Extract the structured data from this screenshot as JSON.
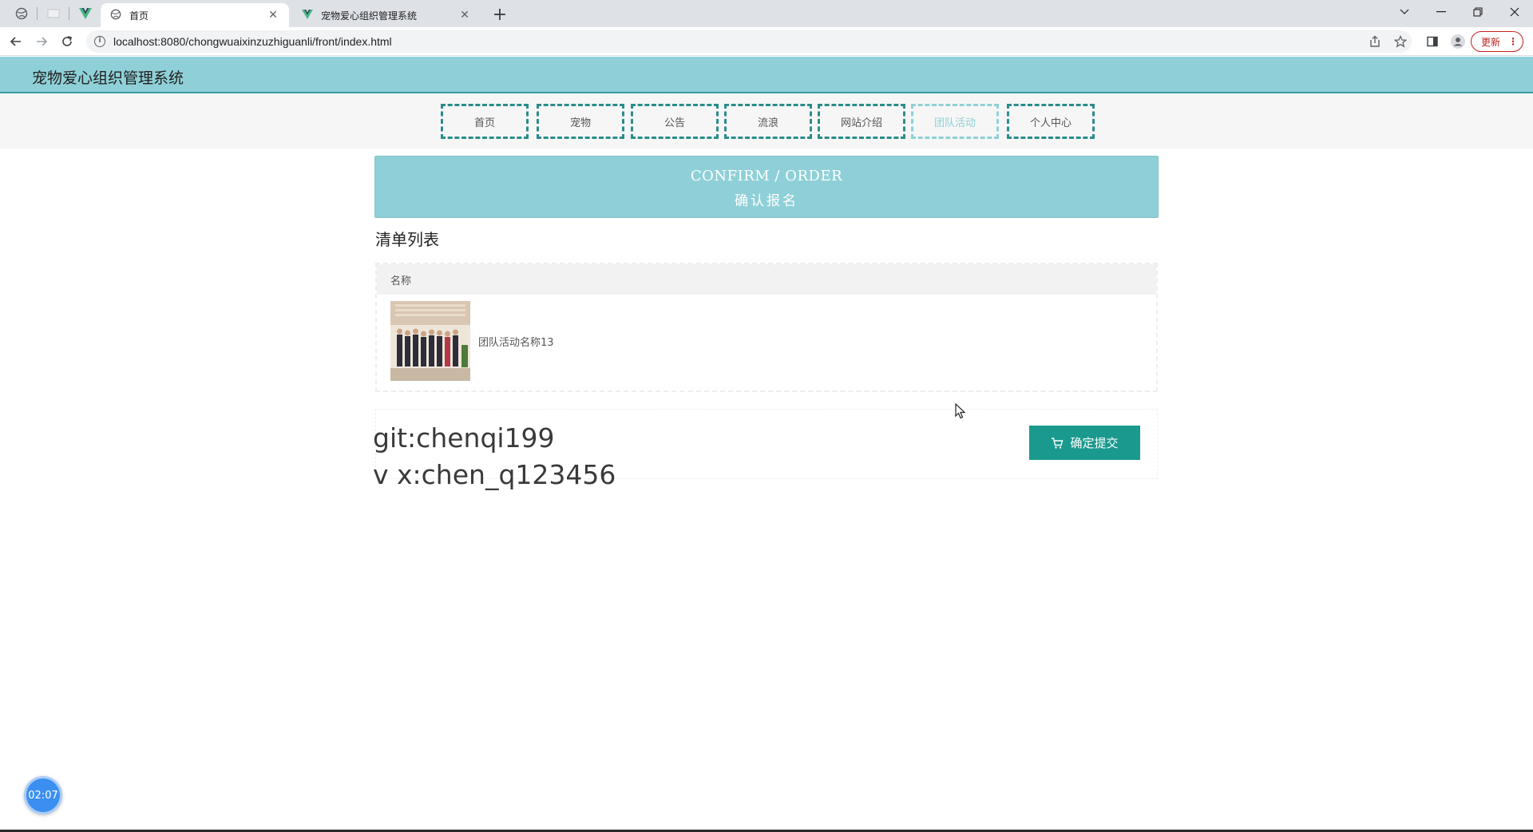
{
  "browser": {
    "tabs": [
      {
        "title": "首页",
        "active": true
      },
      {
        "title": "宠物爱心组织管理系统",
        "active": false
      }
    ],
    "url": "localhost:8080/chongwuaixinzuzhiguanli/front/index.html",
    "update_label": "更新"
  },
  "site": {
    "title": "宠物爱心组织管理系统"
  },
  "nav": {
    "items": [
      "首页",
      "宠物",
      "公告",
      "流浪",
      "网站介绍",
      "团队活动",
      "个人中心"
    ],
    "active": "团队活动"
  },
  "banner": {
    "title_en": "CONFIRM / ORDER",
    "title_cn": "确认报名"
  },
  "list": {
    "heading": "清单列表",
    "column_name": "名称",
    "rows": [
      {
        "name": "团队活动名称13"
      }
    ]
  },
  "footer": {
    "watermark_line1": "git:chenqi199",
    "watermark_line2": "v x:chen_q123456",
    "submit_label": "确定提交"
  },
  "timer": {
    "value": "02:07"
  },
  "colors": {
    "header_bg": "#8fd0d8",
    "nav_border": "#2a8c8c",
    "submit_bg": "#1a9a8e"
  }
}
